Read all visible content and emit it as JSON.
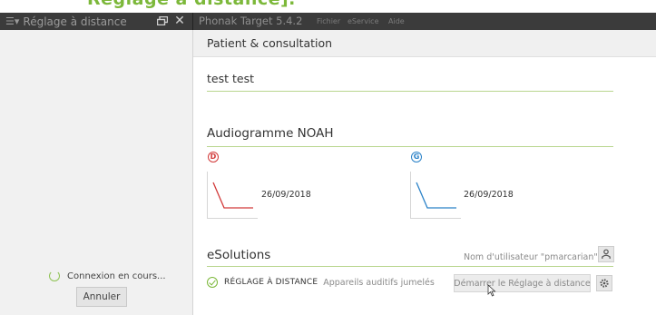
{
  "banner": {
    "text": "Réglage à distance]."
  },
  "titlebar": {
    "menu_glyph": "☰▾",
    "panel_title": "Réglage à distance",
    "close_glyph": "✕",
    "app_title": "Phonak Target 5.4.2",
    "menu": [
      "Fichier",
      "eService",
      "Aide"
    ]
  },
  "left_panel": {
    "status": "Connexion en cours...",
    "cancel_label": "Annuler"
  },
  "main": {
    "section_title": "Patient & consultation",
    "patient_name": "test test",
    "audiogram": {
      "title": "Audiogramme NOAH",
      "right": {
        "ear_letter": "D",
        "date": "26/09/2018",
        "color": "#d23a3a"
      },
      "left": {
        "ear_letter": "G",
        "date": "26/09/2018",
        "color": "#2a82c8"
      }
    },
    "esolutions": {
      "title": "eSolutions",
      "username_label": "Nom d'utilisateur \"pmarcarian\"",
      "remote_title": "RÉGLAGE À DISTANCE",
      "remote_status": "Appareils auditifs jumelés",
      "start_label": "Démarrer le Réglage à distance"
    }
  },
  "icons": [
    "menu-icon",
    "restore-icon",
    "close-icon",
    "spinner-icon",
    "right-ear-icon",
    "left-ear-icon",
    "user-icon",
    "check-circle-icon",
    "gear-icon",
    "cursor-icon"
  ],
  "colors": {
    "accent": "#7cb83a",
    "titlebar": "#3b3b3b",
    "right_ear": "#d23a3a",
    "left_ear": "#2a82c8"
  }
}
